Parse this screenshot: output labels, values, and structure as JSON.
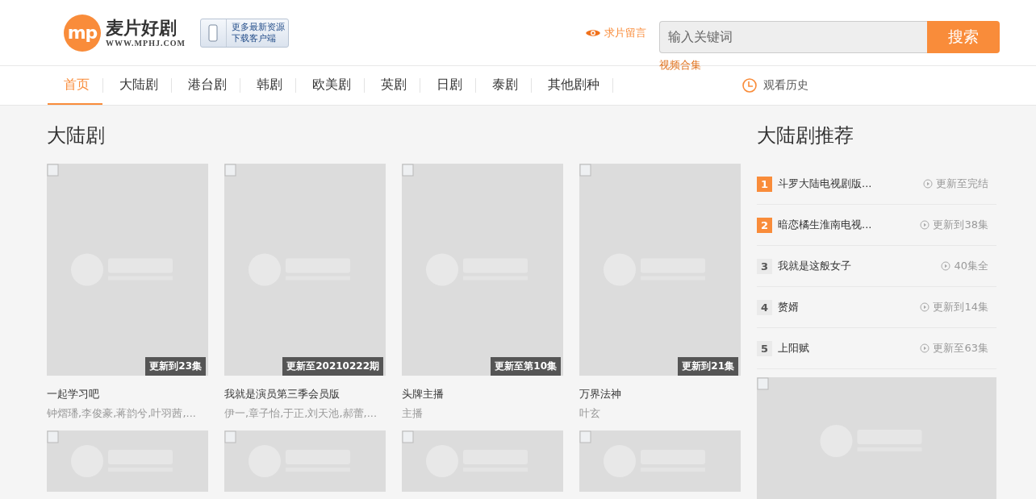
{
  "header": {
    "logo": {
      "mark": "mp",
      "name": "麦片好剧",
      "url": "WWW.MPHJ.COM"
    },
    "app_badge": {
      "lines": [
        "更多最新资源",
        "下载客户端"
      ]
    },
    "request_link": "求片留言",
    "search": {
      "placeholder": "输入关键词",
      "button": "搜索"
    },
    "collection_link": "视频合集"
  },
  "nav": {
    "items": [
      {
        "label": "首页",
        "selected": true
      },
      {
        "label": "大陆剧",
        "selected": false
      },
      {
        "label": "港台剧",
        "selected": false
      },
      {
        "label": "韩剧",
        "selected": false
      },
      {
        "label": "欧美剧",
        "selected": false
      },
      {
        "label": "英剧",
        "selected": false
      },
      {
        "label": "日剧",
        "selected": false
      },
      {
        "label": "泰剧",
        "selected": false
      },
      {
        "label": "其他剧种",
        "selected": false
      }
    ],
    "history": "观看历史"
  },
  "main": {
    "title": "大陆剧",
    "cards": [
      {
        "badge": "更新到23集",
        "title": "一起学习吧",
        "cast": "钟熠璠,李俊豪,蒋韵兮,叶羽茜,..."
      },
      {
        "badge": "更新至20210222期",
        "title": "我就是演员第三季会员版",
        "cast": "伊一,章子怡,于正,刘天池,郝蕾,..."
      },
      {
        "badge": "更新至第10集",
        "title": "头牌主播",
        "cast": "主播"
      },
      {
        "badge": "更新到21集",
        "title": "万界法神",
        "cast": "叶玄"
      }
    ]
  },
  "sidebar": {
    "title": "大陆剧推荐",
    "items": [
      {
        "rank": "1",
        "hot": true,
        "title": "斗罗大陆电视剧版...",
        "status": "更新至完结"
      },
      {
        "rank": "2",
        "hot": true,
        "title": "暗恋橘生淮南电视...",
        "status": "更新到38集"
      },
      {
        "rank": "3",
        "hot": false,
        "title": "我就是这般女子",
        "status": "40集全"
      },
      {
        "rank": "4",
        "hot": false,
        "title": "赘婿",
        "status": "更新到14集"
      },
      {
        "rank": "5",
        "hot": false,
        "title": "上阳赋",
        "status": "更新至63集"
      }
    ]
  }
}
